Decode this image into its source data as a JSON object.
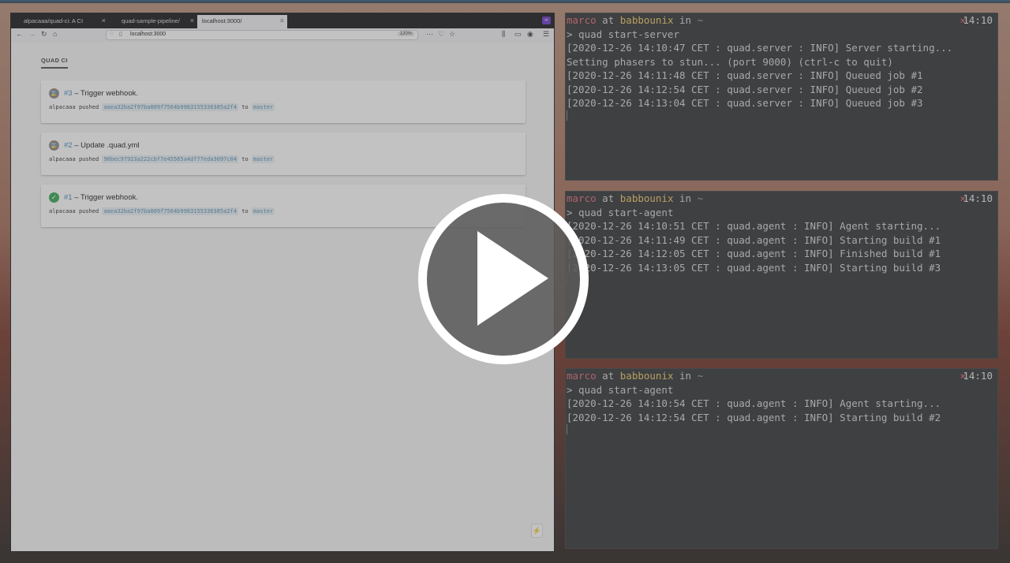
{
  "browser": {
    "tabs": [
      {
        "label": "alpacaaa/quad-ci: A CI"
      },
      {
        "label": "quad-sample-pipeline/"
      },
      {
        "label": "localhost:3000/"
      }
    ],
    "new_tab": "+",
    "url": "localhost:3000",
    "zoom": "120%",
    "brand": "QUAD CI",
    "builds": [
      {
        "number": "#3",
        "title": "– Trigger webhook.",
        "status": "pending",
        "user": "alpacaaa",
        "verb": "pushed",
        "commit": "aaea32ba2f97ba009f7564b9983155336385a2f4",
        "to": "to",
        "branch": "master"
      },
      {
        "number": "#2",
        "title": "– Update .quad.yml",
        "status": "pending",
        "user": "alpacaaa",
        "verb": "pushed",
        "commit": "96bec97923a222cbf7e45565a4df77eda3097c04",
        "to": "to",
        "branch": "master"
      },
      {
        "number": "#1",
        "title": "– Trigger webhook.",
        "status": "done",
        "user": "alpacaaa",
        "verb": "pushed",
        "commit": "aaea32ba2f97ba009f7564b9983155336385a2f4",
        "to": "to",
        "branch": "master"
      }
    ]
  },
  "terminals": [
    {
      "user": "marco",
      "at": "at",
      "host": "babbounix",
      "in": "in",
      "dir": "~",
      "x": "×",
      "time": "14:10",
      "command": "> quad start-server",
      "lines": [
        "[2020-12-26 14:10:47 CET : quad.server : INFO] Server starting...",
        "Setting phasers to stun... (port 9000) (ctrl-c to quit)",
        "[2020-12-26 14:11:48 CET : quad.server : INFO] Queued job #1",
        "[2020-12-26 14:12:54 CET : quad.server : INFO] Queued job #2",
        "[2020-12-26 14:13:04 CET : quad.server : INFO] Queued job #3"
      ]
    },
    {
      "user": "marco",
      "at": "at",
      "host": "babbounix",
      "in": "in",
      "dir": "~",
      "x": "×",
      "time": "14:10",
      "command": "> quad start-agent",
      "lines": [
        "[2020-12-26 14:10:51 CET : quad.agent : INFO] Agent starting...",
        "[2020-12-26 14:11:49 CET : quad.agent : INFO] Starting build #1",
        "[2020-12-26 14:12:05 CET : quad.agent : INFO] Finished build #1",
        "[2020-12-26 14:13:05 CET : quad.agent : INFO] Starting build #3"
      ]
    },
    {
      "user": "marco",
      "at": "at",
      "host": "babbounix",
      "in": "in",
      "dir": "~",
      "x": "×",
      "time": "14:10",
      "command": "> quad start-agent",
      "lines": [
        "[2020-12-26 14:10:54 CET : quad.agent : INFO] Agent starting...",
        "[2020-12-26 14:12:54 CET : quad.agent : INFO] Starting build #2"
      ]
    }
  ],
  "icons": {
    "back": "←",
    "forward": "→",
    "reload": "↻",
    "home": "⌂",
    "menu": "☰",
    "bolt": "⚡",
    "done": "✓",
    "pending": "⌛"
  }
}
